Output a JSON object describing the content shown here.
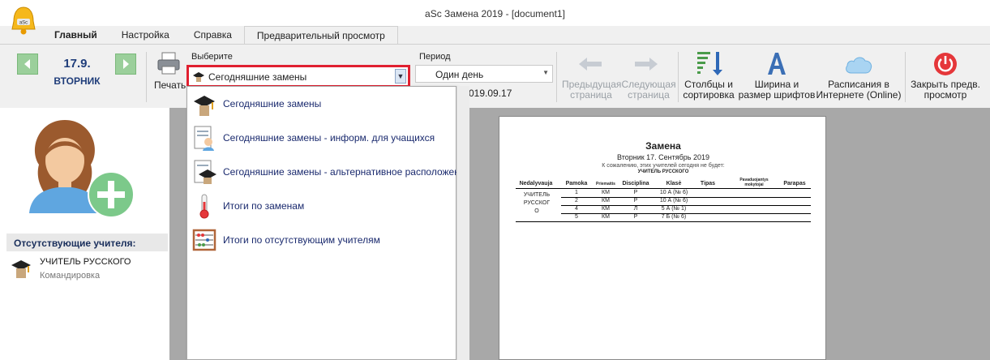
{
  "window": {
    "title": "aSc Замена 2019  - [document1]"
  },
  "tabs": [
    {
      "label": "Главный"
    },
    {
      "label": "Настройка"
    },
    {
      "label": "Справка"
    },
    {
      "label": "Предварительный просмотр"
    }
  ],
  "date": {
    "number": "17.9.",
    "weekday": "ВТОРНИК"
  },
  "ribbon": {
    "print_label": "Печать",
    "select_label": "Выберите",
    "select_value": "Сегодняшние замены",
    "period_label": "Период",
    "period_value": "Один день",
    "period_date": "019.09.17",
    "prev_page": [
      "Предыдущая",
      "страница"
    ],
    "next_page": [
      "Следующая",
      "страница"
    ],
    "columns_sort": [
      "Столбцы и",
      "сортировка"
    ],
    "font_width": [
      "Ширина и",
      "размер шрифтов"
    ],
    "online": [
      "Расписания в",
      "Интернете (Online)"
    ],
    "close_preview": [
      "Закрыть предв.",
      "просмотр"
    ]
  },
  "left_panel": {
    "absent_header": "Отсутствующие учителя:",
    "teacher_name": "УЧИТЕЛЬ РУССКОГО",
    "teacher_status": "Командировка"
  },
  "dropdown": {
    "items": [
      {
        "label": "Сегодняшние замены",
        "icon": "graduation-cap-icon"
      },
      {
        "label": "Сегодняшние замены - информ. для учащихся",
        "icon": "student-doc-icon"
      },
      {
        "label": "Сегодняшние замены - альтернативное расположени",
        "icon": "cap-doc-icon"
      },
      {
        "label": "Итоги по заменам",
        "icon": "thermometer-icon"
      },
      {
        "label": "Итоги по отсутствующим учителям",
        "icon": "abacus-icon"
      }
    ]
  },
  "document": {
    "title": "Замена",
    "subtitle": "Вторник 17. Сентябрь 2019",
    "note": "К сожалению, этих учителей сегодня не будет:",
    "teacher_header": "УЧИТЕЛЬ РУССКОГО",
    "headers": [
      "Nedalyvauja",
      "Pamoka",
      "Priemaitis",
      "Disciplina",
      "Klasė",
      "Tipas",
      "Pavaduojantys mokytojai",
      "Parapas"
    ],
    "teacher_cell": [
      "УЧИТЕЛЬ",
      "РУССКОГ",
      "О"
    ],
    "rows": [
      [
        "1",
        "КМ",
        "Р",
        "10 А (№ 6)"
      ],
      [
        "2",
        "КМ",
        "Р",
        "10 А (№ 6)"
      ],
      [
        "4",
        "КМ",
        "Л",
        "5 А (№ 1)"
      ],
      [
        "5",
        "КМ",
        "Р",
        "7 Б (№ 6)"
      ]
    ]
  },
  "colors": {
    "accent_red": "#e02030",
    "nav_green": "#9bcf9b",
    "link_blue": "#1a2a6e"
  }
}
